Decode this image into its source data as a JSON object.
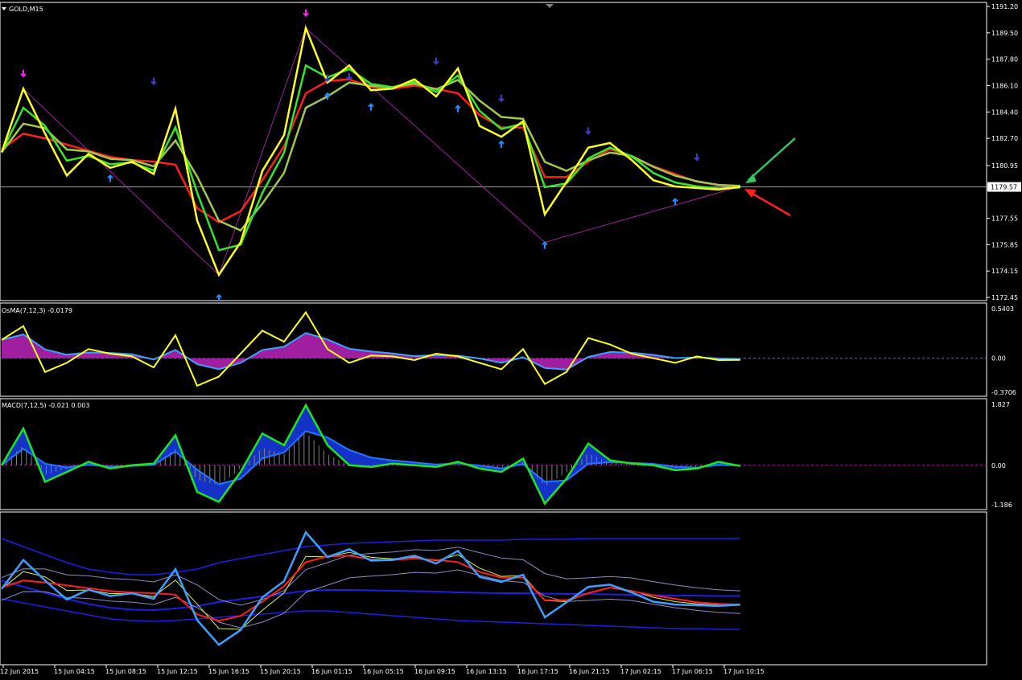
{
  "chart_data": [
    {
      "type": "line",
      "title": "GOLD,M15",
      "ylim": [
        1172.45,
        1191.2
      ],
      "price_ticks": [
        "1191.20",
        "1189.50",
        "1187.80",
        "1186.10",
        "1184.40",
        "1182.70",
        "1180.95",
        "1177.55",
        "1175.85",
        "1174.15",
        "1172.45"
      ],
      "current_price": "1179.57",
      "colors": {
        "price": "#ffff1e",
        "fast": "#32e632",
        "mid": "#a0c850",
        "slow": "#ff1e1e",
        "zigzag": "#a020a0",
        "arrow_down": "#3c3ccd",
        "arrow_up": "#1e8cff",
        "arrow_top": "#ff1eff",
        "pointer_green": "#32c864",
        "pointer_red": "#ff2020"
      },
      "price_series": [
        1181.8,
        1185.9,
        1183.0,
        1180.3,
        1181.7,
        1180.8,
        1181.2,
        1180.4,
        1184.6,
        1177.4,
        1173.9,
        1176.0,
        1180.6,
        1182.9,
        1189.8,
        1186.3,
        1187.4,
        1185.8,
        1185.9,
        1186.5,
        1185.4,
        1187.2,
        1183.5,
        1182.8,
        1183.8,
        1177.8,
        1179.9,
        1182.1,
        1182.4,
        1181.3,
        1180.0,
        1179.6,
        1179.5,
        1179.4,
        1179.57
      ],
      "slow_ma": [
        1182.0,
        1183.0,
        1182.7,
        1182.3,
        1181.9,
        1181.5,
        1181.3,
        1181.2,
        1181.0,
        1178.2,
        1177.3,
        1178.0,
        1180.0,
        1182.2,
        1185.6,
        1186.4,
        1186.5,
        1186.0,
        1185.9,
        1186.1,
        1185.9,
        1185.6,
        1184.2,
        1183.4,
        1183.4,
        1180.2,
        1180.2,
        1181.2,
        1182.0,
        1181.5,
        1180.9,
        1180.4,
        1179.9,
        1179.7,
        1179.6
      ],
      "zigzag": [
        [
          0,
          1181.8
        ],
        [
          1,
          1185.9
        ],
        [
          10,
          1173.9
        ],
        [
          14,
          1189.8
        ],
        [
          25,
          1176.0
        ],
        [
          34,
          1179.6
        ]
      ],
      "arrows_down": [
        [
          7,
          1186.2
        ],
        [
          15,
          1186.4
        ],
        [
          16,
          1186.5
        ],
        [
          20,
          1187.5
        ],
        [
          23,
          1185.1
        ],
        [
          27,
          1183.0
        ],
        [
          32,
          1181.3
        ]
      ],
      "arrows_up": [
        [
          5,
          1180.3
        ],
        [
          15,
          1185.6
        ],
        [
          17,
          1184.9
        ],
        [
          21,
          1184.8
        ],
        [
          23,
          1182.5
        ],
        [
          25,
          1176.0
        ],
        [
          10,
          1172.6
        ],
        [
          31,
          1178.8
        ]
      ]
    },
    {
      "type": "area",
      "title": "OsMA(7,12,3) -0.0179",
      "ylim": [
        -0.3706,
        0.5403
      ],
      "ticks": [
        "0.5403",
        "0.00",
        "-0.3706"
      ],
      "colors": {
        "osma": "#a01ea0",
        "line": "#ffff1e",
        "signal": "#3ca0ff"
      },
      "values": [
        0.2,
        0.35,
        -0.15,
        -0.05,
        0.1,
        0.05,
        0.02,
        -0.1,
        0.25,
        -0.3,
        -0.2,
        0.05,
        0.3,
        0.18,
        0.5,
        0.1,
        -0.05,
        0.03,
        0.02,
        -0.02,
        0.05,
        0.02,
        -0.05,
        -0.12,
        0.1,
        -0.28,
        -0.15,
        0.22,
        0.15,
        0.05,
        0.0,
        -0.05,
        0.02,
        -0.02,
        -0.0179
      ]
    },
    {
      "type": "bar",
      "title": "MACD(7,12,5) -0.021 0.003",
      "ylim": [
        -1.186,
        1.827
      ],
      "ticks": [
        "1.827",
        "0.00",
        "-1.186"
      ],
      "colors": {
        "main": "#1ee61e",
        "signal": "#1e78ff",
        "histogram": "#808080",
        "fill": "#1432c8"
      },
      "values": [
        0.0,
        1.1,
        -0.5,
        -0.2,
        0.1,
        -0.1,
        0.0,
        0.05,
        0.9,
        -0.8,
        -1.1,
        -0.2,
        0.95,
        0.6,
        1.8,
        0.6,
        0.0,
        -0.05,
        0.05,
        0.0,
        -0.05,
        0.1,
        -0.1,
        -0.2,
        0.2,
        -1.15,
        -0.4,
        0.65,
        0.15,
        0.05,
        0.0,
        -0.15,
        -0.1,
        0.1,
        -0.021
      ]
    },
    {
      "type": "line",
      "title": "",
      "colors": {
        "price": "#3ca0ff",
        "ma": "#ff1e1e",
        "band": "#8c8cc8",
        "envelope": "#1e1ee6",
        "signal": "#d2f050"
      },
      "envelope_upper": [
        670,
        680,
        690,
        700,
        708,
        712,
        715,
        715,
        712,
        708,
        700,
        695,
        690,
        685,
        680,
        678,
        676,
        675,
        674,
        673,
        672,
        672,
        672,
        672,
        671,
        671,
        671,
        670,
        670,
        670,
        670,
        670,
        670,
        670,
        670
      ],
      "envelope_lower": [
        745,
        750,
        755,
        760,
        765,
        770,
        772,
        773,
        772,
        770,
        768,
        766,
        764,
        762,
        760,
        760,
        762,
        764,
        766,
        768,
        770,
        772,
        773,
        774,
        775,
        776,
        777,
        778,
        779,
        780,
        781,
        782,
        782,
        783,
        783
      ]
    }
  ],
  "time_axis": [
    "12 Jun 2015",
    "15 Jun 04:15",
    "15 Jun 08:15",
    "15 Jun 12:15",
    "15 Jun 16:15",
    "15 Jun 20:15",
    "16 Jun 01:15",
    "16 Jun 05:15",
    "16 Jun 09:15",
    "16 Jun 13:15",
    "16 Jun 17:15",
    "16 Jun 21:15",
    "17 Jun 02:15",
    "17 Jun 06:15",
    "17 Jun 10:15"
  ]
}
